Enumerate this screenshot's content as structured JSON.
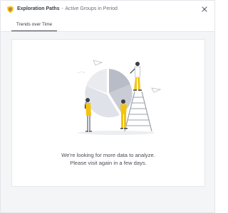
{
  "header": {
    "title": "Exploration Paths",
    "separator": "-",
    "subtitle": "Active Groups in Period",
    "icons": {
      "logo": "shield-logo-icon",
      "close": "close-icon"
    }
  },
  "tabs": [
    {
      "label": "Trends over Time",
      "active": true
    }
  ],
  "empty_state": {
    "line1": "We're looking for more data to analyze.",
    "line2": "Please visit again in a few days.",
    "illustration": "people-building-pie-chart-illustration"
  },
  "colors": {
    "accent_yellow": "#f2c40f",
    "pie_gray": "#b8bcc6",
    "pie_light": "#dfe2e8",
    "text_dark": "#3a3e46"
  }
}
